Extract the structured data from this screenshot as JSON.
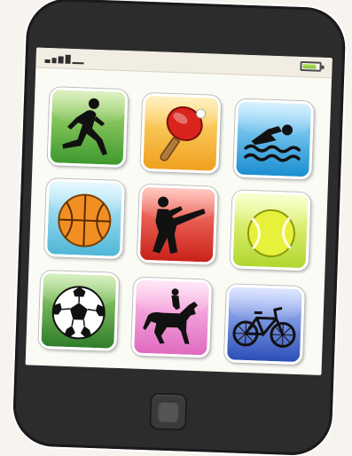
{
  "status_bar": {
    "signal_bars": 4,
    "battery_level": 0.85,
    "battery_color": "#8cc63f"
  },
  "apps": [
    {
      "name": "running",
      "icon": "runner-icon",
      "color": "#4fa534"
    },
    {
      "name": "table-tennis",
      "icon": "ping-pong-paddle-icon",
      "color": "#f4b32a"
    },
    {
      "name": "swimming",
      "icon": "swimmer-icon",
      "color": "#1e95d6"
    },
    {
      "name": "basketball",
      "icon": "basketball-icon",
      "color": "#4fb6d6"
    },
    {
      "name": "karate",
      "icon": "martial-arts-icon",
      "color": "#d4342a"
    },
    {
      "name": "tennis",
      "icon": "tennis-ball-icon",
      "color": "#b8d93a"
    },
    {
      "name": "soccer",
      "icon": "soccer-ball-icon",
      "color": "#3a8a34"
    },
    {
      "name": "horse-riding",
      "icon": "equestrian-icon",
      "color": "#e27ac7"
    },
    {
      "name": "cycling",
      "icon": "bicycle-icon",
      "color": "#3158bd"
    }
  ]
}
